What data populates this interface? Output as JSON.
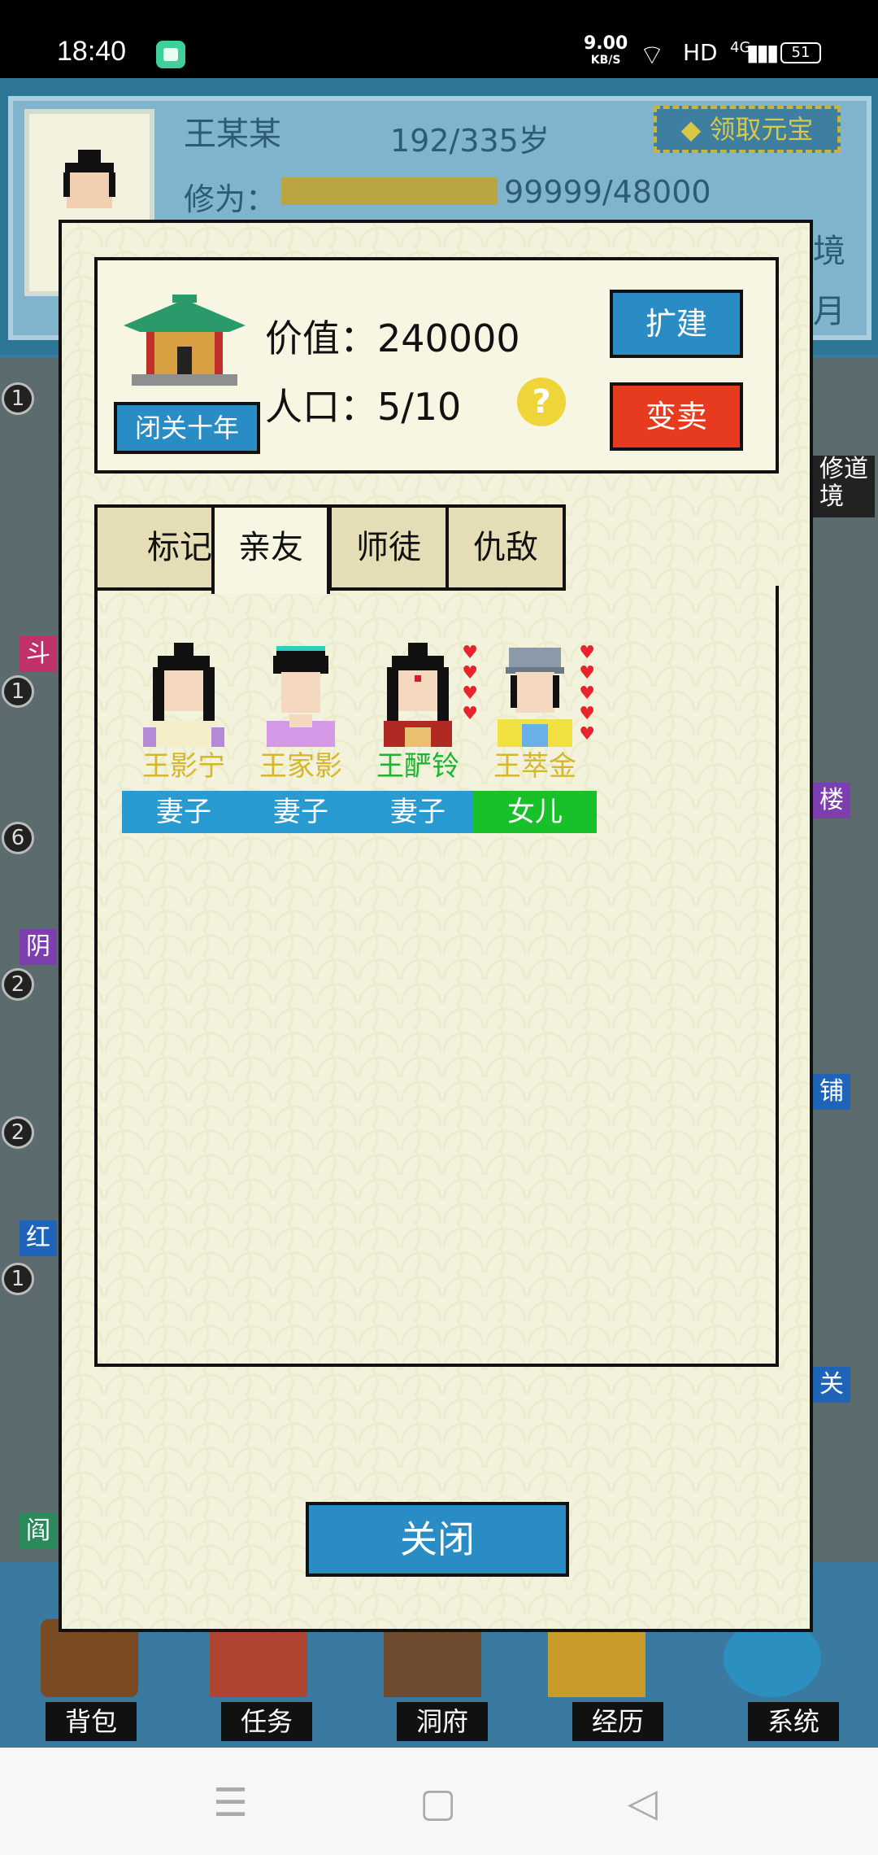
{
  "status_bar": {
    "time": "18:40",
    "net_speed": "9.00",
    "net_unit": "KB/S",
    "hd": "HD",
    "network": "4G",
    "battery": "51"
  },
  "background": {
    "player_name": "王某某",
    "age": "192/335岁",
    "claim_button": "领取元宝",
    "cultivation_label": "修为：",
    "cultivation_value": "99999/48000",
    "realm_fragment": "境",
    "month_fragment": "月",
    "list_counts": [
      "1",
      "1",
      "6",
      "2",
      "2",
      "1"
    ],
    "left_tags": [
      "斗",
      "阴",
      "红",
      "阎"
    ],
    "right_tags": [
      "修道\n境",
      "楼",
      "铺",
      "关"
    ],
    "nav": [
      "背包",
      "任务",
      "洞府",
      "经历",
      "系统"
    ]
  },
  "dialog": {
    "retreat_button": "闭关十年",
    "value_label": "价值：240000",
    "population_label": "人口：5/10",
    "help_symbol": "?",
    "expand_button": "扩建",
    "sell_button": "变卖",
    "tabs": [
      {
        "label": "标记",
        "active": false
      },
      {
        "label": "亲友",
        "active": true
      },
      {
        "label": "师徒",
        "active": false
      },
      {
        "label": "仇敌",
        "active": false
      }
    ],
    "members": [
      {
        "name": "王影宁",
        "relation": "妻子",
        "name_color": "#d6b72a",
        "relation_color": "#2a9ad2",
        "hearts": 0
      },
      {
        "name": "王家影",
        "relation": "妻子",
        "name_color": "#d6b72a",
        "relation_color": "#2a9ad2",
        "hearts": 0
      },
      {
        "name": "王酽铃",
        "relation": "妻子",
        "name_color": "#22b232",
        "relation_color": "#2a9ad2",
        "hearts": 4
      },
      {
        "name": "王萃金",
        "relation": "女儿",
        "name_color": "#d6b72a",
        "relation_color": "#18c02a",
        "hearts": 5
      }
    ],
    "close_button": "关闭"
  },
  "colors": {
    "accent_blue": "#2a8cc4",
    "danger_red": "#e63b1f",
    "panel_bg": "#f3f3dd"
  }
}
